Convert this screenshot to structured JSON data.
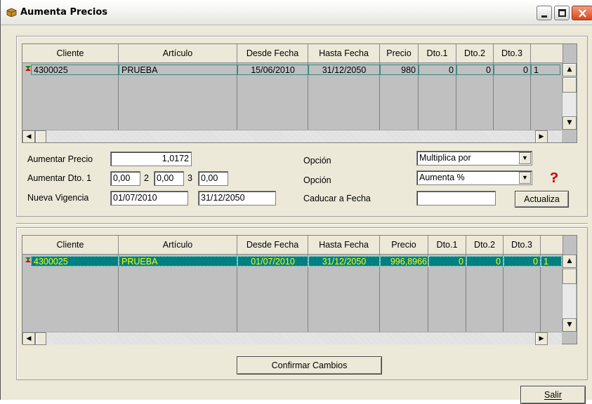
{
  "window": {
    "title": "Aumenta Precios"
  },
  "grid1": {
    "columns": [
      "Cliente",
      "Artículo",
      "Desde Fecha",
      "Hasta Fecha",
      "Precio",
      "Dto.1",
      "Dto.2",
      "Dto.3"
    ],
    "row": {
      "cliente": "4300025",
      "articulo": "PRUEBA",
      "desde": "15/06/2010",
      "hasta": "31/12/2050",
      "precio": "980",
      "dto1": "0",
      "dto2": "0",
      "dto3": "0",
      "extra": "1"
    }
  },
  "form": {
    "aumentar_precio_label": "Aumentar Precio",
    "aumentar_precio_value": "1,0172",
    "aumentar_dto_label": "Aumentar Dto. 1",
    "dto1_value": "0,00",
    "dto2_label": "2",
    "dto2_value": "0,00",
    "dto3_label": "3",
    "dto3_value": "0,00",
    "nueva_vigencia_label": "Nueva Vigencia",
    "vigencia_desde": "01/07/2010",
    "vigencia_hasta": "31/12/2050",
    "opcion1_label": "Opción",
    "opcion1_value": "Multiplica por",
    "opcion2_label": "Opción",
    "opcion2_value": "Aumenta %",
    "caducar_label": "Caducar a Fecha",
    "caducar_value": "",
    "actualiza_label": "Actualiza"
  },
  "grid2": {
    "columns": [
      "Cliente",
      "Artículo",
      "Desde Fecha",
      "Hasta Fecha",
      "Precio",
      "Dto.1",
      "Dto.2",
      "Dto.3"
    ],
    "row": {
      "cliente": "4300025",
      "articulo": "PRUEBA",
      "desde": "01/07/2010",
      "hasta": "31/12/2050",
      "precio": "996,8966",
      "dto1": "0",
      "dto2": "0",
      "dto3": "0",
      "extra": "1"
    }
  },
  "buttons": {
    "confirmar": "Confirmar Cambios",
    "salir": "Salir"
  },
  "colors": {
    "selected_row_bg": "#008080",
    "selected_row_text": "#ffff00"
  }
}
